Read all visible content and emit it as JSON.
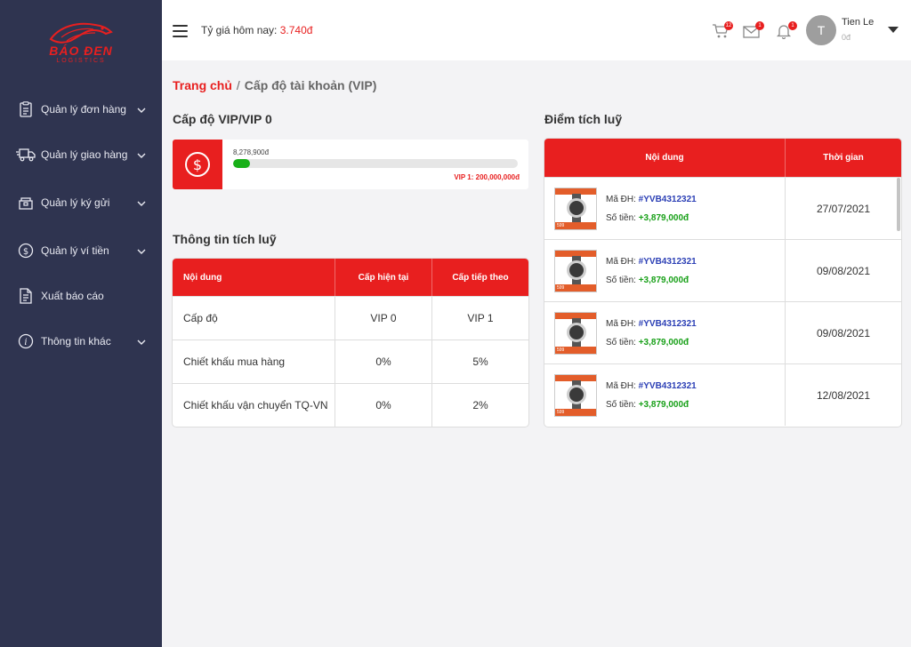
{
  "sidebar": {
    "logo": {
      "brand": "BÁO ĐEN",
      "sub": "LOGISTICS"
    },
    "items": [
      {
        "label": "Quản lý đơn hàng",
        "icon": "clipboard-icon",
        "has_chevron": true
      },
      {
        "label": "Quản lý giao hàng",
        "icon": "truck-icon",
        "has_chevron": true
      },
      {
        "label": "Quản lý ký gửi",
        "icon": "package-icon",
        "has_chevron": true
      },
      {
        "label": "Quản lý ví tiền",
        "icon": "dollar-circle-icon",
        "has_chevron": true
      },
      {
        "label": "Xuất báo cáo",
        "icon": "report-export-icon",
        "has_chevron": false
      },
      {
        "label": "Thông tin khác",
        "icon": "info-icon",
        "has_chevron": true
      }
    ]
  },
  "header": {
    "rate_label": "Tỷ giá hôm nay: ",
    "rate_value": "3.740đ",
    "cart_count": "12",
    "mail_count": "1",
    "bell_count": "1",
    "avatar_initial": "T",
    "user_name": "Tien Le",
    "user_balance": "0đ"
  },
  "breadcrumb": {
    "home": "Trang chủ",
    "separator": "/",
    "current": "Cấp độ tài khoản (VIP)"
  },
  "vip": {
    "title": "Cấp độ VIP/VIP 0",
    "current_amount": "8,278,900đ",
    "progress": 0.0414,
    "next_level": "VIP 1: 200,000,000đ"
  },
  "accum_info": {
    "title": "Thông tin tích luỹ",
    "headers": [
      "Nội dung",
      "Cấp hiện tại",
      "Cấp tiếp theo"
    ],
    "rows": [
      [
        "Cấp độ",
        "VIP 0",
        "VIP 1"
      ],
      [
        "Chiết khấu mua hàng",
        "0%",
        "5%"
      ],
      [
        "Chiết khấu vận chuyển TQ-VN",
        "0%",
        "2%"
      ]
    ]
  },
  "points": {
    "title": "Điểm tích luỹ",
    "headers": [
      "Nội dung",
      "Thời gian"
    ],
    "order_label": "Mã ĐH: ",
    "amount_label": "Số tiền: ",
    "rows": [
      {
        "order": "#YVB4312321",
        "amount": "+3,879,000đ",
        "date": "27/07/2021"
      },
      {
        "order": "#YVB4312321",
        "amount": "+3,879,000đ",
        "date": "09/08/2021"
      },
      {
        "order": "#YVB4312321",
        "amount": "+3,879,000đ",
        "date": "09/08/2021"
      },
      {
        "order": "#YVB4312321",
        "amount": "+3,879,000đ",
        "date": "12/08/2021"
      }
    ]
  },
  "colors": {
    "accent": "#e81f1f",
    "sidebar": "#2f3450",
    "success": "#18a018",
    "link": "#2b3fb5"
  }
}
